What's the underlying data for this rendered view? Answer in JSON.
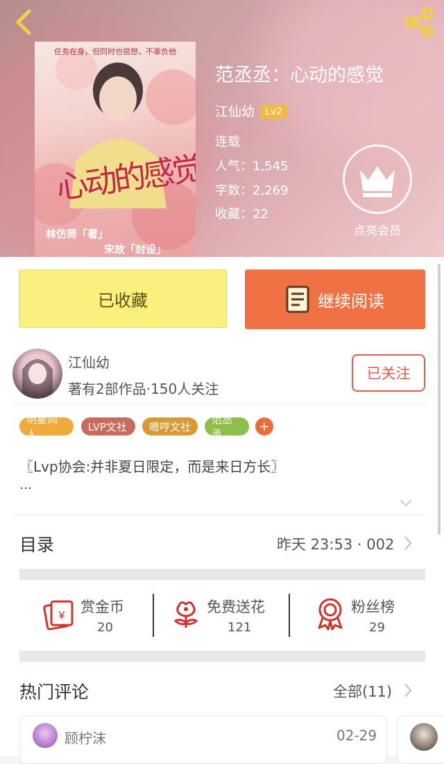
{
  "book": {
    "title": "范丞丞：心动的感觉",
    "author": "江仙幼",
    "level": "Lv2",
    "status": "连载",
    "popularity": "人气：1,545",
    "word_count": "字数：2,269",
    "favorites": "收藏：22"
  },
  "vip": {
    "label": "点亮会员"
  },
  "actions": {
    "favorited": "已收藏",
    "continue_reading": "继续阅读"
  },
  "author_panel": {
    "name": "江仙幼",
    "desc": "著有2部作品·150人关注",
    "follow": "已关注"
  },
  "tags": [
    {
      "label": "明星同人",
      "color": "#f0a93a"
    },
    {
      "label": "LVP文社",
      "color": "#c96a5a"
    },
    {
      "label": "嗯哼文社",
      "color": "#d99a32"
    },
    {
      "label": "范丞丞",
      "color": "#8fbf4a"
    }
  ],
  "tag_more": "+",
  "intro": {
    "line1": "〖Lvp协会:并非夏日限定，而是来日方长〗",
    "line2": "…"
  },
  "toc": {
    "title": "目录",
    "latest": "昨天 23:53 · 002"
  },
  "stats": [
    {
      "label": "赏金币",
      "value": "20",
      "icon": "coin-card-icon"
    },
    {
      "label": "免费送花",
      "value": "121",
      "icon": "flower-icon"
    },
    {
      "label": "粉丝榜",
      "value": "29",
      "icon": "medal-icon"
    }
  ],
  "comments": {
    "title": "热门评论",
    "all": "全部(11)",
    "items": [
      {
        "user": "顾柠沫",
        "date": "02-29"
      }
    ]
  },
  "cover_text": {
    "top": "任务在身，但同时也很想，不辜负他",
    "art": "心动的感觉",
    "credit1": "林仿茼「著」",
    "credit2": "宋故「封设」"
  },
  "colors": {
    "accent_orange": "#f07143",
    "fav_yellow": "#faf07e",
    "follow_red": "#e35a4a",
    "icon_red": "#d3322a"
  }
}
